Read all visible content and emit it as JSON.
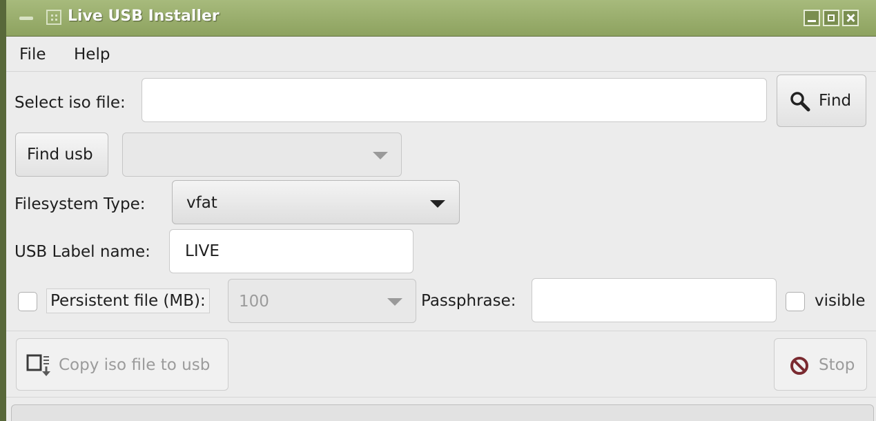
{
  "window": {
    "title": "Live USB Installer"
  },
  "menu": {
    "file": "File",
    "help": "Help"
  },
  "iso": {
    "label": "Select iso file:",
    "value": "",
    "find_label": "Find"
  },
  "usb": {
    "find_label": "Find usb",
    "selected": ""
  },
  "filesystem": {
    "label": "Filesystem Type:",
    "selected": "vfat"
  },
  "usb_label": {
    "label": "USB Label name:",
    "value": "LIVE"
  },
  "persistent": {
    "checked": false,
    "label": "Persistent file (MB):",
    "selected": "100"
  },
  "passphrase": {
    "label": "Passphrase:",
    "value": "",
    "visible_label": "visible",
    "visible_checked": false
  },
  "actions": {
    "copy_label": "Copy iso file to usb",
    "stop_label": "Stop"
  },
  "icons": {
    "find": "magnifier-icon",
    "copy": "copy-to-usb-icon",
    "stop": "stop-icon"
  }
}
